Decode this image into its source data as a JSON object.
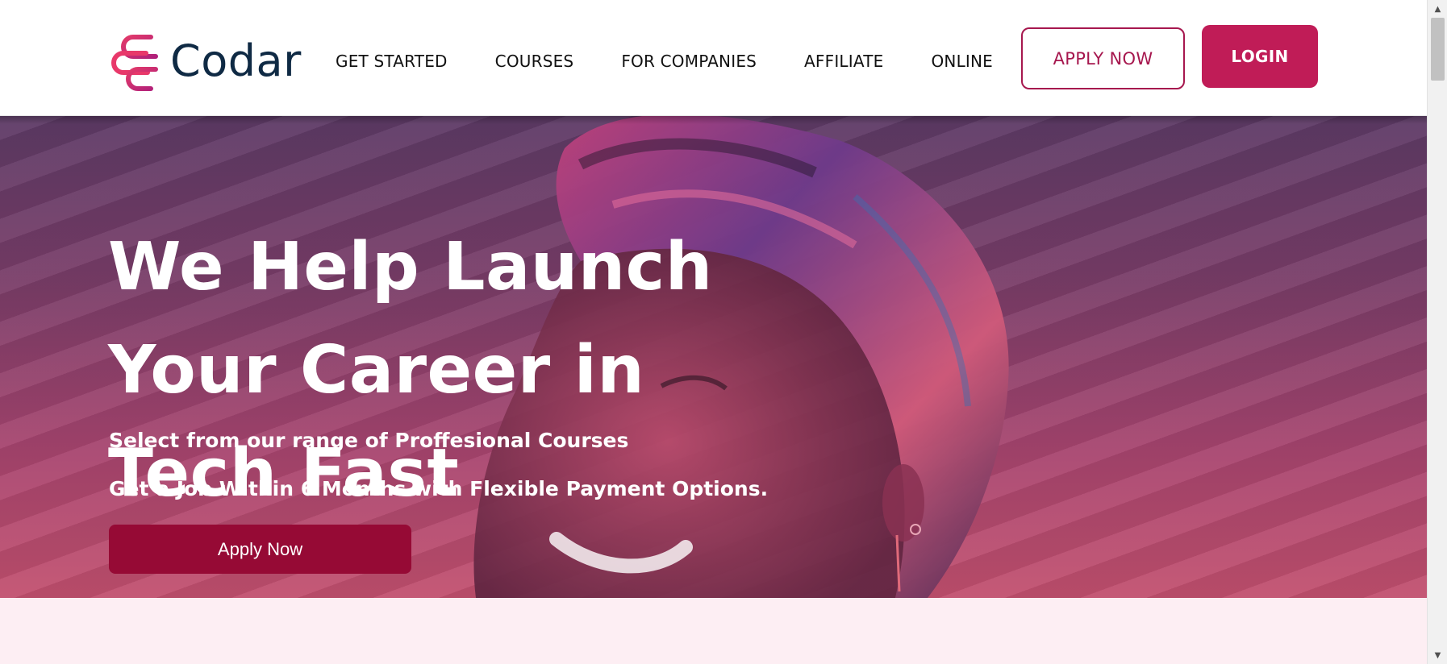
{
  "header": {
    "logo_text": "Codar",
    "nav": [
      {
        "label": "GET STARTED"
      },
      {
        "label": "COURSES"
      },
      {
        "label": "FOR COMPANIES"
      },
      {
        "label": "AFFILIATE"
      },
      {
        "label": "ONLINE"
      }
    ],
    "apply_label": "APPLY NOW",
    "login_label": "LOGIN"
  },
  "hero": {
    "title": "We Help Launch Your Career in Tech Fast",
    "subtitle_1": "Select from our range of Proffesional Courses",
    "subtitle_2": "Get a Job Within 6 Months with Flexible Payment Options.",
    "cta_label": "Apply Now"
  },
  "colors": {
    "brand_pink": "#c01c57",
    "brand_dark_pink": "#960a35",
    "outline_pink": "#a6174e",
    "logo_navy": "#0f2a44",
    "section_bg": "#fdeef3"
  },
  "icons": {
    "logo": "codar-logo-icon",
    "scroll_up": "chevron-up-icon",
    "scroll_down": "chevron-down-icon"
  }
}
